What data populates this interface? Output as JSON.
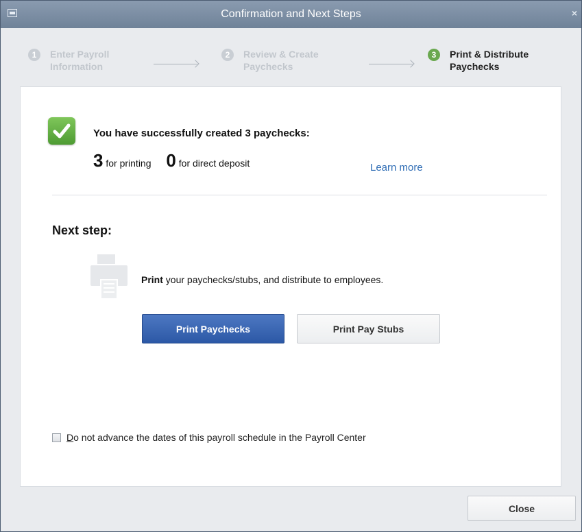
{
  "window": {
    "title": "Confirmation and Next Steps",
    "close_glyph": "×"
  },
  "steps": [
    {
      "number": "1",
      "label": "Enter Payroll Information",
      "state": "inactive"
    },
    {
      "number": "2",
      "label": "Review & Create Paychecks",
      "state": "inactive"
    },
    {
      "number": "3",
      "label": "Print & Distribute Paychecks",
      "state": "active"
    }
  ],
  "summary": {
    "headline": "You have successfully created 3 paychecks:",
    "printing_count": "3",
    "printing_label": "for printing",
    "deposit_count": "0",
    "deposit_label": "for direct deposit",
    "learn_more": "Learn more"
  },
  "next_step": {
    "heading": "Next step:",
    "action_word": "Print",
    "description": " your paychecks/stubs, and distribute to employees.",
    "print_paychecks_label": "Print Paychecks",
    "print_stubs_label": "Print Pay Stubs"
  },
  "option": {
    "checkbox_label_underlined": "D",
    "checkbox_label_rest": "o not advance the dates of this payroll schedule in the Payroll Center",
    "checked": false
  },
  "footer": {
    "close_label": "Close"
  },
  "colors": {
    "accent_green": "#6aa84f",
    "primary_button": "#2c58a6",
    "link": "#2f6db5"
  },
  "icons": [
    "window-menu-icon",
    "close-icon",
    "success-check-icon",
    "printer-icon"
  ]
}
